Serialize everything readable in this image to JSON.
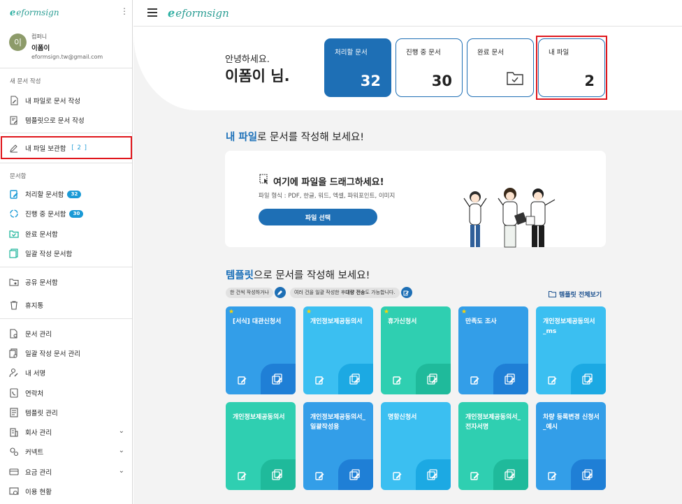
{
  "brand": {
    "name": "eformsign"
  },
  "user": {
    "avatar_initial": "이",
    "company": "컴퍼니",
    "name": "이폼이",
    "email": "eformsign.tw@gmail.com"
  },
  "sidebar": {
    "sections": {
      "new_doc": "새 문서 작성",
      "doc_box": "문서함"
    },
    "items": {
      "create_from_file": "내 파일로 문서 작성",
      "create_from_template": "템플릿으로 문서 작성",
      "my_file_box": "내 파일 보관함",
      "my_file_count": "[ 2 ]",
      "to_process": "처리할 문서함",
      "to_process_count": "32",
      "in_progress": "진행 중 문서함",
      "in_progress_count": "30",
      "completed": "완료 문서함",
      "bulk_box": "일괄 작성 문서함",
      "shared": "공유 문서함",
      "trash": "휴지통",
      "doc_manage": "문서 관리",
      "bulk_manage": "일괄 작성 문서 관리",
      "my_signature": "내 서명",
      "contacts": "연락처",
      "template_manage": "템플릿 관리",
      "company_manage": "회사 관리",
      "connect": "커넥트",
      "billing": "요금 관리",
      "usage": "이용 현황"
    }
  },
  "hero": {
    "greeting": "안녕하세요.",
    "name": "이폼이 님.",
    "stats": {
      "to_process": {
        "label": "처리할 문서",
        "value": "32"
      },
      "in_progress": {
        "label": "진행 중 문서",
        "value": "30"
      },
      "completed": {
        "label": "완료 문서"
      },
      "my_files": {
        "label": "내 파일",
        "value": "2"
      }
    }
  },
  "upload": {
    "heading_highlight": "내 파일",
    "heading_rest": "로 문서를 작성해 보세요!",
    "drop_title": "여기에 파일을 드래그하세요!",
    "formats": "파일 형식 : PDF, 한글, 워드, 엑셀, 파워포인트, 이미지",
    "select_button": "파일 선택"
  },
  "templates": {
    "heading_highlight": "템플릿",
    "heading_rest": "으로 문서를 작성해 보세요!",
    "pill1": "한 건씩 작성하거나",
    "pill2_pre": "여러 건을 일괄 작성한 후 ",
    "pill2_bold": "대량 전송",
    "pill2_post": "도 가능합니다.",
    "view_all": "템플릿 전체보기",
    "cards": [
      {
        "title": "[서식] 대관신청서",
        "starred": true,
        "color": "blue"
      },
      {
        "title": "개인정보제공동의서",
        "starred": true,
        "color": "sky"
      },
      {
        "title": "휴가신청서",
        "starred": true,
        "color": "teal"
      },
      {
        "title": "만족도 조사",
        "starred": true,
        "color": "blue"
      },
      {
        "title": "개인정보제공동의서_ms",
        "starred": false,
        "color": "sky"
      },
      {
        "title": "개인정보제공동의서",
        "starred": false,
        "color": "teal"
      },
      {
        "title": "개인정보제공동의서_일괄작성용",
        "starred": false,
        "color": "blue"
      },
      {
        "title": "명함신청서",
        "starred": false,
        "color": "sky"
      },
      {
        "title": "개인정보제공동의서_전자서명",
        "starred": false,
        "color": "teal"
      },
      {
        "title": "차량 등록변경 신청서_예시",
        "starred": false,
        "color": "blue"
      }
    ]
  }
}
